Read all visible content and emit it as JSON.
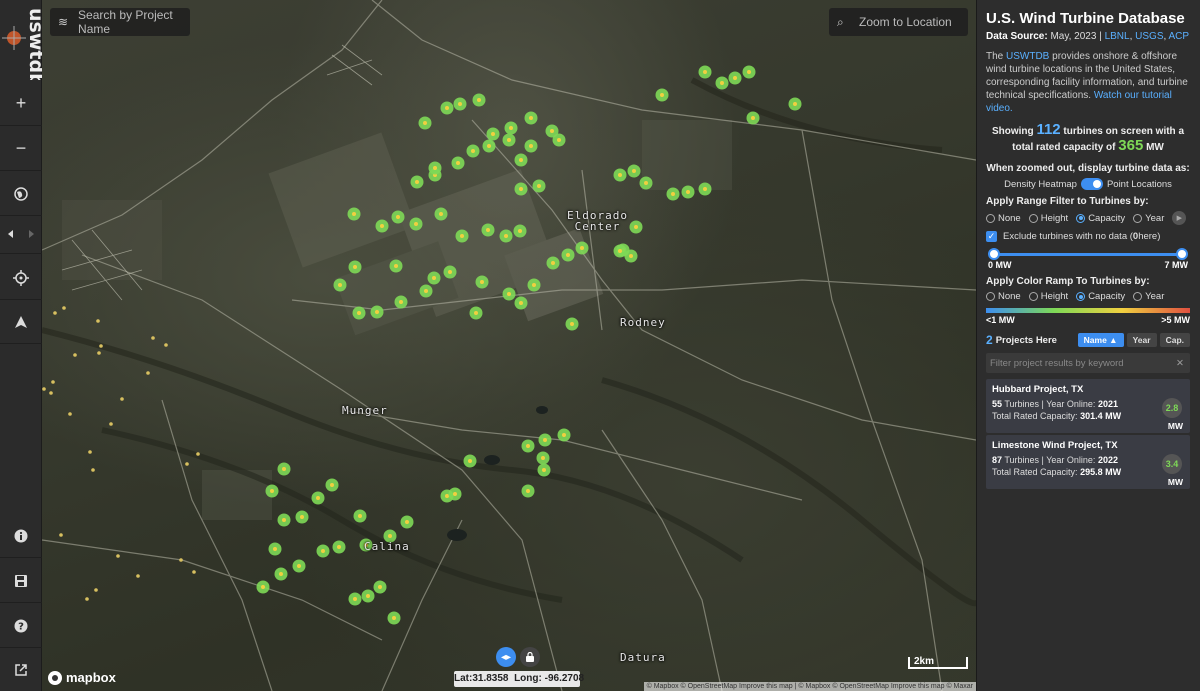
{
  "app": {
    "logo_text": "uswtdb"
  },
  "toolbar": {
    "zoom_in": "+",
    "zoom_out": "−"
  },
  "map": {
    "search_placeholder": "Search by Project Name",
    "zoom_placeholder": "Zoom to Location",
    "towns": [
      "Eldorado Center",
      "Rodney",
      "Munger",
      "Calina",
      "Datura"
    ],
    "eldorado_line1": "Eldorado",
    "eldorado_line2": "Center",
    "coords_lat_label": "Lat:",
    "coords_lat": "31.8358",
    "coords_long_label": "Long:",
    "coords_long": "-96.2708",
    "scale": "2km",
    "mapbox": "mapbox",
    "attribution": "© Mapbox © OpenStreetMap Improve this map | © Mapbox © OpenStreetMap Improve this map © Maxar",
    "turbine_color": "#7ed957",
    "turbine_center_color": "#f0d040",
    "other_turbine_color": "#d8c060"
  },
  "panel": {
    "title": "U.S. Wind Turbine Database",
    "source_label": "Data Source:",
    "source_date": "May, 2023 |",
    "source_links": [
      "LBNL",
      "USGS",
      "ACP"
    ],
    "desc_pre": "The",
    "desc_link": "USWTDB",
    "desc_body": "provides onshore & offshore wind turbine locations in the United States, corresponding facility information, and turbine technical specifications.",
    "desc_video": "Watch our tutorial video.",
    "showing_pre": "Showing",
    "showing_count": "112",
    "showing_mid": "turbines on screen with a total rated capacity of",
    "showing_capacity": "365",
    "showing_unit": "MW",
    "zoom_label": "When zoomed out, display turbine data as:",
    "toggle_left": "Density Heatmap",
    "toggle_right": "Point Locations",
    "range_label": "Apply Range Filter to Turbines by:",
    "range_options": [
      "None",
      "Height",
      "Capacity",
      "Year"
    ],
    "range_selected": "Capacity",
    "exclude_pre": "Exclude turbines with no data (",
    "exclude_count": "0",
    "exclude_post": " here)",
    "slider_min": "0 MW",
    "slider_max": "7 MW",
    "color_label": "Apply Color Ramp To Turbines by:",
    "color_options": [
      "None",
      "Height",
      "Capacity",
      "Year"
    ],
    "color_selected": "Capacity",
    "ramp_min": "<1 MW",
    "ramp_max": ">5 MW",
    "projects_count": "2",
    "projects_label": "Projects Here",
    "sort_buttons": [
      "Name ▲",
      "Year",
      "Cap."
    ],
    "filter_placeholder": "Filter project results by keyword",
    "filter_clear": "✕",
    "projects": [
      {
        "name": "Hubbard Project, TX",
        "turbines": "55",
        "turbines_label": "Turbines | Year Online:",
        "year": "2021",
        "cap_label": "Total Rated Capacity:",
        "capacity": "301.4 MW",
        "badge": "2.8",
        "unit": "MW"
      },
      {
        "name": "Limestone Wind Project, TX",
        "turbines": "87",
        "turbines_label": "Turbines | Year Online:",
        "year": "2022",
        "cap_label": "Total Rated Capacity:",
        "capacity": "295.8 MW",
        "badge": "3.4",
        "unit": "MW"
      }
    ]
  },
  "colors": {
    "accent": "#3d8ef0",
    "link": "#5ab0ff",
    "capacity_green": "#7ed957",
    "panel_bg": "#2d2d2d"
  }
}
